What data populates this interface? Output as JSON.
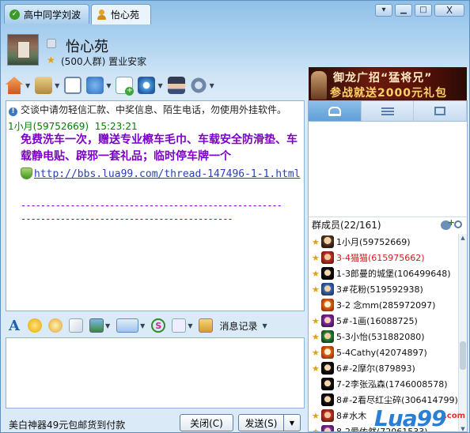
{
  "tabs": [
    {
      "label": "高中同学刘波",
      "active": false
    },
    {
      "label": "怡心苑",
      "active": true
    }
  ],
  "window_controls": {
    "options": "▾",
    "minimize": "▁",
    "maximize": "□",
    "close": "X"
  },
  "group": {
    "name": "怡心苑",
    "meta": "(500人群) 置业安家"
  },
  "banner": {
    "line1": "御龙广招“猛将兄”",
    "line2": "参战就送2000元礼包"
  },
  "chat": {
    "notice": "交谈中请勿轻信汇款、中奖信息、陌生电话，勿使用外挂软件。",
    "message": {
      "sender": "1小月(59752669)",
      "time": "15:23:21",
      "text": "免费洗车一次，赠送专业檫车毛巾、车载安全防滑垫、车载静电贴、辟邪一套礼品；临时停车牌一个",
      "url": "http://bbs.lua99.com/thread-147496-1-1.html",
      "dash_line_1": "-----------------------------------------------------",
      "dash_line_2": "-------------------------------------------"
    }
  },
  "input_toolbar": {
    "history_label": "消息记录"
  },
  "bottom": {
    "ad_text": "美白神器49元包邮货到付款",
    "close_button": "关闭(C)",
    "send_button": "发送(S)"
  },
  "members": {
    "header": "群成员(22/161)",
    "list": [
      {
        "name": "1小月(59752669)",
        "star": true,
        "red": false
      },
      {
        "name": "3-4猫猫(615975662)",
        "star": true,
        "red": true
      },
      {
        "name": "1-3郎曼的城堡(106499648)",
        "star": true,
        "red": false
      },
      {
        "name": "3#花粉(519592938)",
        "star": true,
        "red": false
      },
      {
        "name": "3-2 念mm(285972097)",
        "star": false,
        "red": false
      },
      {
        "name": "5#-1画(16088725)",
        "star": true,
        "red": false
      },
      {
        "name": "5-3小怡(531882080)",
        "star": true,
        "red": false
      },
      {
        "name": "5-4Cathy(42074897)",
        "star": true,
        "red": false
      },
      {
        "name": "6#-2摩尔(879893)",
        "star": true,
        "red": false
      },
      {
        "name": "7-2李张泓森(1746008578)",
        "star": false,
        "red": false
      },
      {
        "name": "8#-2看尽红尘碎(306414799)",
        "star": false,
        "red": false
      },
      {
        "name": "8#水木",
        "star": true,
        "red": false
      },
      {
        "name": "8-2爱依然(72061533)",
        "star": true,
        "red": false
      }
    ]
  },
  "watermark": {
    "brand": "Lua99",
    "sub": ".com"
  },
  "icons": [
    "check-icon",
    "person-icon",
    "home-icon",
    "folder-icon",
    "whiteboard-icon",
    "mic-icon",
    "message-add-icon",
    "camera-icon",
    "police-icon",
    "gear-icon",
    "font-icon",
    "smiley-icon",
    "magic-emoticon-icon",
    "pen-icon",
    "image-icon",
    "screenshot-icon",
    "s-icon",
    "misc-icon",
    "history-icon"
  ]
}
